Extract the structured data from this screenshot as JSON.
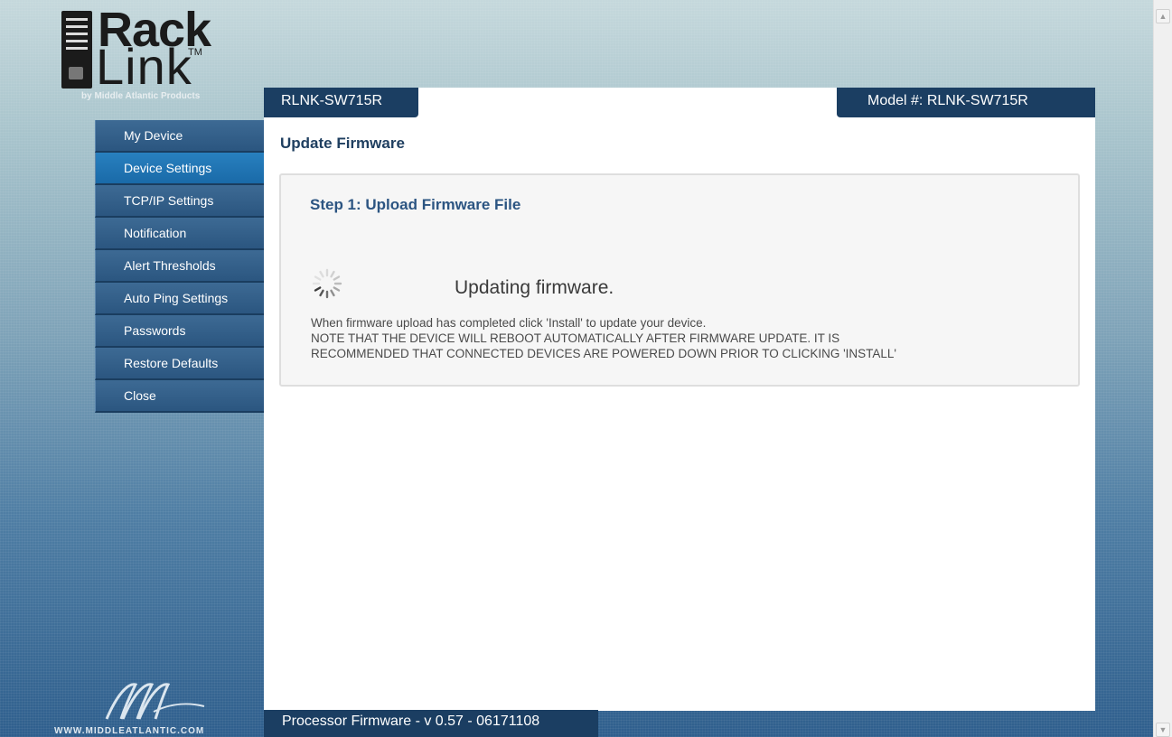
{
  "brand": {
    "logo_word1": "Rack",
    "logo_word2": "Link",
    "logo_tm": "TM",
    "logo_byline": "by Middle Atlantic Products",
    "bottom_url": "WWW.MIDDLEATLANTIC.COM"
  },
  "sidebar": {
    "items": [
      {
        "label": "My Device"
      },
      {
        "label": "Device Settings"
      },
      {
        "label": "TCP/IP Settings"
      },
      {
        "label": "Notification"
      },
      {
        "label": "Alert Thresholds"
      },
      {
        "label": "Auto Ping Settings"
      },
      {
        "label": "Passwords"
      },
      {
        "label": "Restore Defaults"
      },
      {
        "label": "Close"
      }
    ],
    "active_item": "Device Settings"
  },
  "header": {
    "device_name": "RLNK-SW715R",
    "model_label": "Model #: RLNK-SW715R"
  },
  "main": {
    "page_title": "Update Firmware",
    "step_title": "Step 1: Upload Firmware File",
    "status_text": "Updating firmware.",
    "info_line1": "When firmware upload has completed click 'Install' to update your device.",
    "info_line2": "NOTE THAT THE DEVICE WILL REBOOT AUTOMATICALLY AFTER FIRMWARE UPDATE. IT IS",
    "info_line3": "RECOMMENDED THAT CONNECTED DEVICES ARE POWERED DOWN PRIOR TO CLICKING 'INSTALL'"
  },
  "footer": {
    "firmware_version": "Processor Firmware - v 0.57 - 06171108"
  },
  "icons": {
    "spinner": "loading-spinner-icon",
    "scroll_up": "scroll-up-arrow-icon",
    "scroll_down": "scroll-down-arrow-icon"
  },
  "colors": {
    "nav_bg": "#2b5680",
    "nav_active": "#1a6aa8",
    "tab_bg": "#1b3e62",
    "title_color": "#1f3f60",
    "step_title_color": "#2c5582"
  }
}
